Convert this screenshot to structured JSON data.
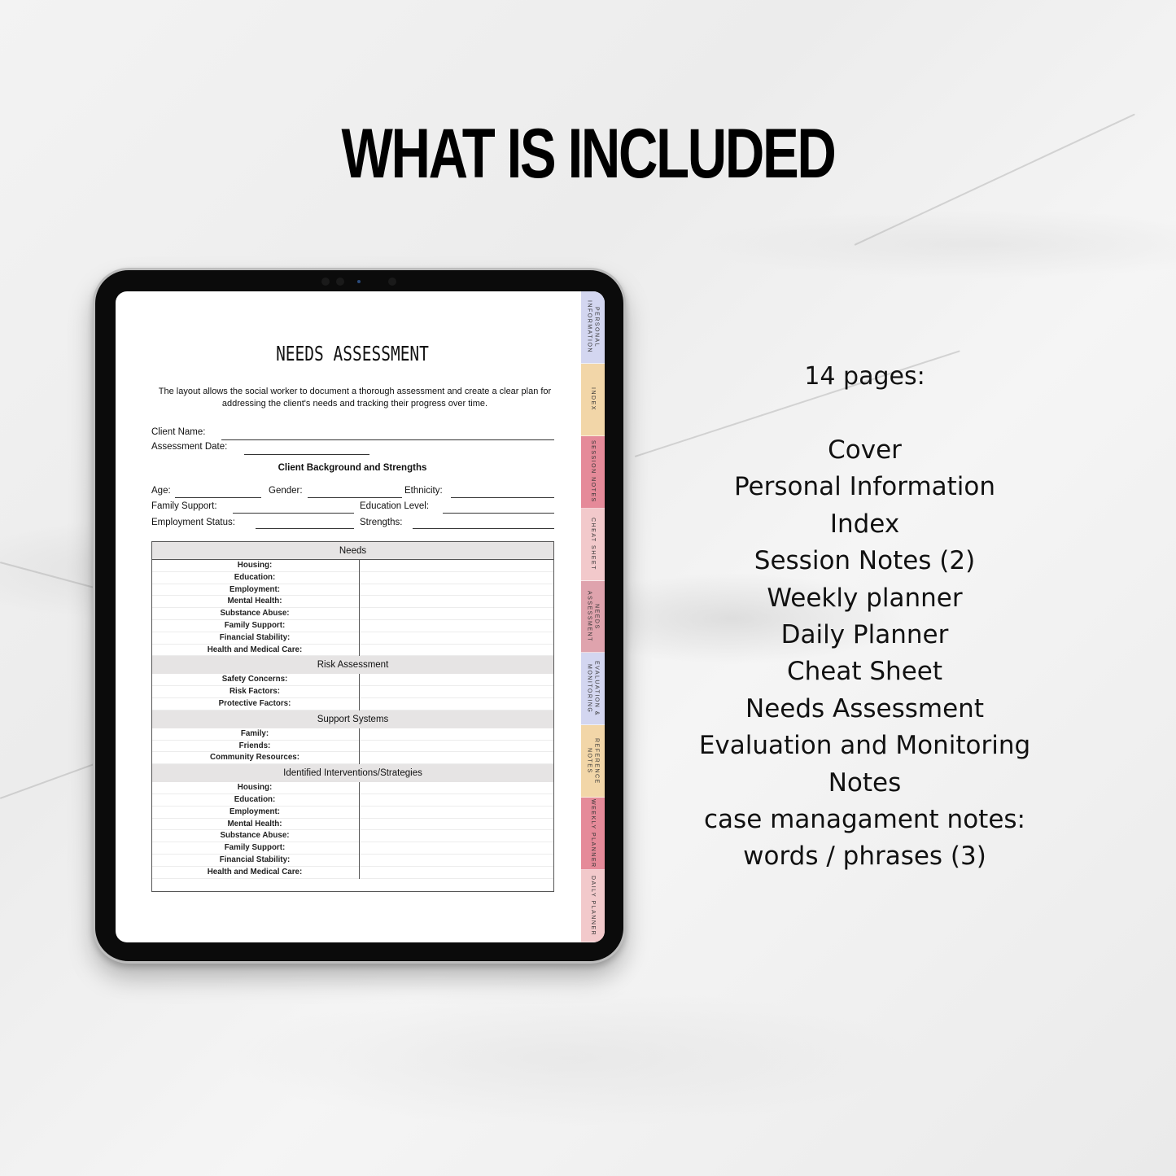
{
  "headline": "WHAT IS INCLUDED",
  "document": {
    "title": "NEEDS ASSESSMENT",
    "intro": "The layout allows the social worker to document a thorough assessment and create a clear plan for addressing the client's needs and tracking their progress over time.",
    "fields": {
      "client_name": "Client Name:",
      "assessment_date": "Assessment Date:",
      "background_heading": "Client Background and Strengths",
      "age": "Age:",
      "gender": "Gender:",
      "ethnicity": "Ethnicity:",
      "family_support": "Family Support:",
      "education_level": "Education Level:",
      "employment_status": "Employment Status:",
      "strengths": "Strengths:"
    },
    "table": {
      "sections": [
        {
          "heading": "Needs",
          "rows": [
            "Housing:",
            "Education:",
            "Employment:",
            "Mental Health:",
            "Substance Abuse:",
            "Family Support:",
            "Financial Stability:",
            "Health and Medical Care:"
          ]
        },
        {
          "heading": "Risk Assessment",
          "rows": [
            "Safety Concerns:",
            "Risk Factors:",
            "Protective Factors:"
          ]
        },
        {
          "heading": "Support Systems",
          "rows": [
            "Family:",
            "Friends:",
            "Community Resources:"
          ]
        },
        {
          "heading": "Identified Interventions/Strategies",
          "rows": [
            "Housing:",
            "Education:",
            "Employment:",
            "Mental Health:",
            "Substance Abuse:",
            "Family Support:",
            "Financial Stability:",
            "Health and Medical Care:"
          ]
        }
      ]
    }
  },
  "tabs": [
    {
      "label": "PERSONAL\nINFORMATION",
      "color": "#d3d6f0"
    },
    {
      "label": "INDEX",
      "color": "#f2d6a8"
    },
    {
      "label": "SESSION NOTES",
      "color": "#e58a99"
    },
    {
      "label": "CHEAT SHEET",
      "color": "#f2c9cb"
    },
    {
      "label": "NEEDS\nASSESSMENT",
      "color": "#dfa3ad"
    },
    {
      "label": "EVALUATION &\nMONITORING",
      "color": "#d3d6f0"
    },
    {
      "label": "REFERENCE\nNOTES",
      "color": "#f2d6a8"
    },
    {
      "label": "WEEKLY PLANNER",
      "color": "#e58a99"
    },
    {
      "label": "DAILY PLANNER",
      "color": "#f2c9cb"
    }
  ],
  "contents": {
    "count": "14 pages:",
    "items": [
      "Cover",
      "Personal Information",
      "Index",
      "Session Notes (2)",
      "Weekly planner",
      "Daily Planner",
      "Cheat Sheet",
      "Needs Assessment",
      "Evaluation and Monitoring",
      "Notes",
      "case managament notes:",
      "words / phrases (3)"
    ]
  }
}
